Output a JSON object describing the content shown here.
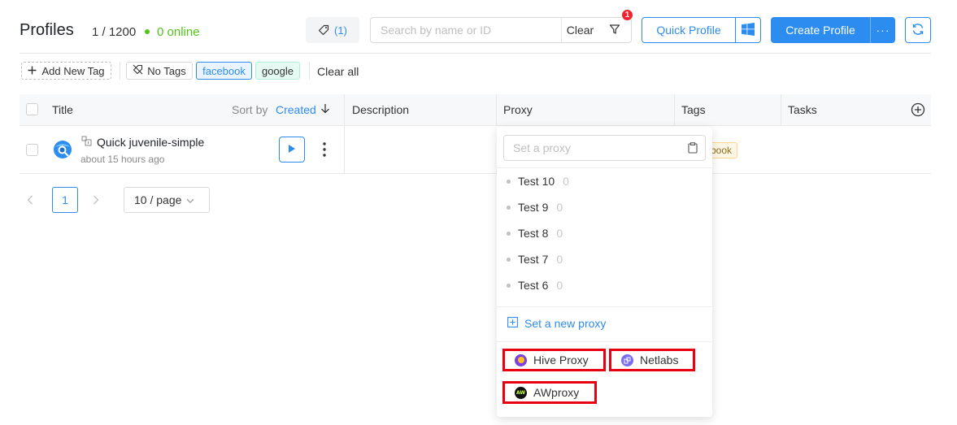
{
  "header": {
    "title": "Profiles",
    "count": "1 / 1200",
    "online": "0 online",
    "tag_filter_count": "(1)",
    "search_placeholder": "Search by name or ID",
    "clear_label": "Clear",
    "filter_badge": "1",
    "quick_profile_label": "Quick Profile",
    "create_profile_label": "Create Profile",
    "more_label": "···"
  },
  "tags_bar": {
    "add_tag_label": "Add New Tag",
    "no_tags_label": "No Tags",
    "tags": [
      "facebook",
      "google"
    ],
    "clear_all_label": "Clear all"
  },
  "table": {
    "columns": {
      "title": "Title",
      "sort_by": "Sort by",
      "sort_field": "Created",
      "description": "Description",
      "proxy": "Proxy",
      "tags": "Tags",
      "tasks": "Tasks"
    },
    "rows": [
      {
        "name": "Quick juvenile-simple",
        "created": "about 15 hours ago",
        "tag_peek": "book"
      }
    ]
  },
  "pagination": {
    "current_page": "1",
    "page_size": "10 / page"
  },
  "proxy_dropdown": {
    "placeholder": "Set a proxy",
    "items": [
      {
        "name": "Test 10",
        "count": "0"
      },
      {
        "name": "Test 9",
        "count": "0"
      },
      {
        "name": "Test 8",
        "count": "0"
      },
      {
        "name": "Test 7",
        "count": "0"
      },
      {
        "name": "Test 6",
        "count": "0"
      }
    ],
    "set_new_label": "Set a new proxy",
    "providers": [
      "Hive Proxy",
      "Netlabs",
      "AWproxy"
    ]
  },
  "colors": {
    "accent": "#2d8cf0",
    "online": "#52c41a",
    "highlight": "#e60012",
    "badge": "#f5222d"
  }
}
